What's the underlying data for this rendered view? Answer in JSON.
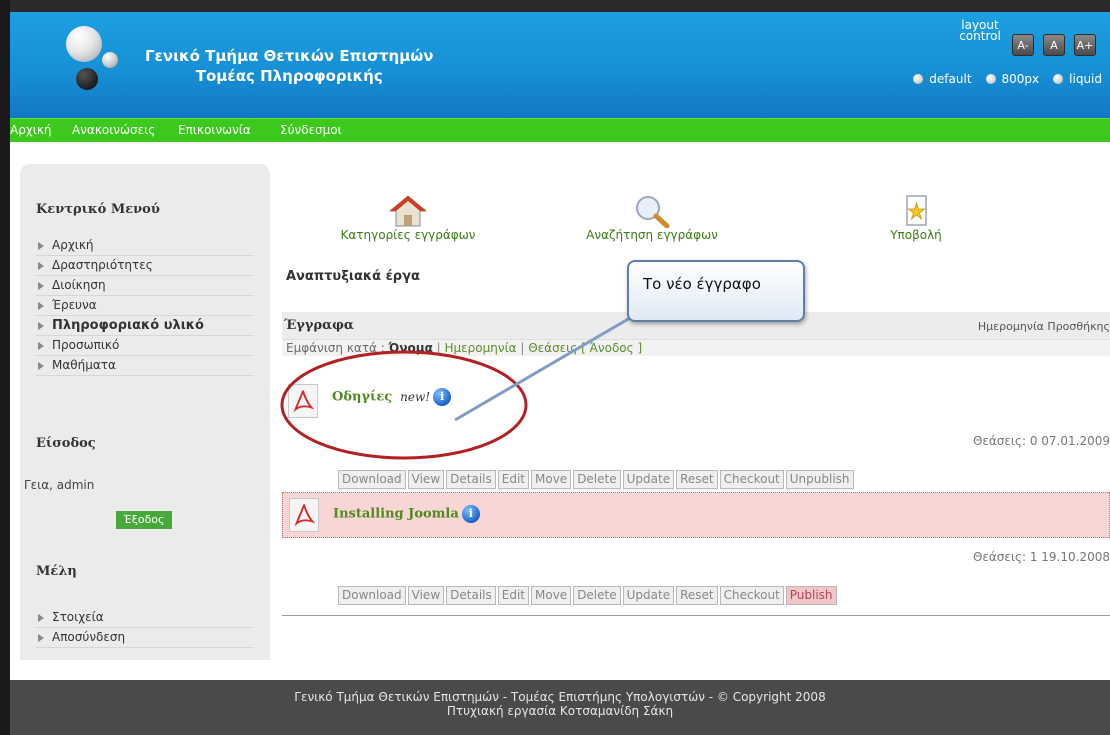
{
  "site": {
    "title_line1": "Γενικό Τμήμα Θετικών Επιστημών",
    "title_line2": "Τομέας Πληροφορικής"
  },
  "layout_control": {
    "label": "layout control",
    "font_buttons": [
      "A-",
      "A",
      "A+"
    ],
    "options": [
      "default",
      "800px",
      "liquid"
    ]
  },
  "nav": {
    "items": [
      "Αρχική",
      "Ανακοινώσεις",
      "Επικοινωνία",
      "Σύνδεσμοι"
    ]
  },
  "sidebar": {
    "main_menu_title": "Κεντρικό Μενού",
    "main_menu": [
      "Αρχική",
      "Δραστηριότητες",
      "Διοίκηση",
      "Έρευνα",
      "Πληροφοριακό υλικό",
      "Προσωπικό",
      "Μαθήματα"
    ],
    "login_title": "Είσοδος",
    "greeting": "Γεια, admin",
    "logout_label": "Έξοδος",
    "members_title": "Μέλη",
    "members_menu": [
      "Στοιχεία",
      "Αποσύνδεση"
    ]
  },
  "tools": {
    "categories": "Κατηγορίες εγγράφων",
    "search": "Αναζήτηση εγγράφων",
    "submit": "Υποβολή"
  },
  "section_title": "Αναπτυξιακά έργα",
  "documents_bar": {
    "title": "Έγγραφα",
    "date_header": "Ημερομηνία Προσθήκης"
  },
  "sort": {
    "prefix": "Εμφάνιση κατά :",
    "by_name": "Όνομα",
    "by_date": "Ημερομηνία",
    "by_views": "Θεάσεις",
    "order": "[ Άνοδος ]"
  },
  "documents": [
    {
      "name": "Οδηγίες",
      "new_badge": "new!",
      "views_line": "Θεάσεις: 0 07.01.2009",
      "highlighted": false,
      "actions": [
        "Download",
        "View",
        "Details",
        "Edit",
        "Move",
        "Delete",
        "Update",
        "Reset",
        "Checkout",
        "Unpublish"
      ]
    },
    {
      "name": "Installing Joomla",
      "new_badge": "",
      "views_line": "Θεάσεις: 1 19.10.2008",
      "highlighted": true,
      "actions": [
        "Download",
        "View",
        "Details",
        "Edit",
        "Move",
        "Delete",
        "Update",
        "Reset",
        "Checkout",
        "Publish"
      ]
    }
  ],
  "annotation": {
    "callout_text": "Το νέο έγγραφο"
  },
  "footer": {
    "line1": "Γενικό Τμήμα Θετικών Επιστημών - Τομέας Επιστήμης Υπολογιστών - © Copyright 2008",
    "line2": "Πτυχιακή εργασία Κοτσαμανίδη Σάκη"
  },
  "colors": {
    "header_blue": "#1790d6",
    "nav_green": "#3cc81c",
    "link_green": "#4f8a1e",
    "highlight_row": "#f9d6d6",
    "highlight_border": "#d06a6a",
    "footer_bg": "#4a4a4a",
    "annotation_red": "#b22222"
  },
  "icons": {
    "categories": "house-icon",
    "search": "magnifier-icon",
    "submit": "star-document-icon",
    "document": "pdf-icon",
    "info": "info-icon"
  }
}
